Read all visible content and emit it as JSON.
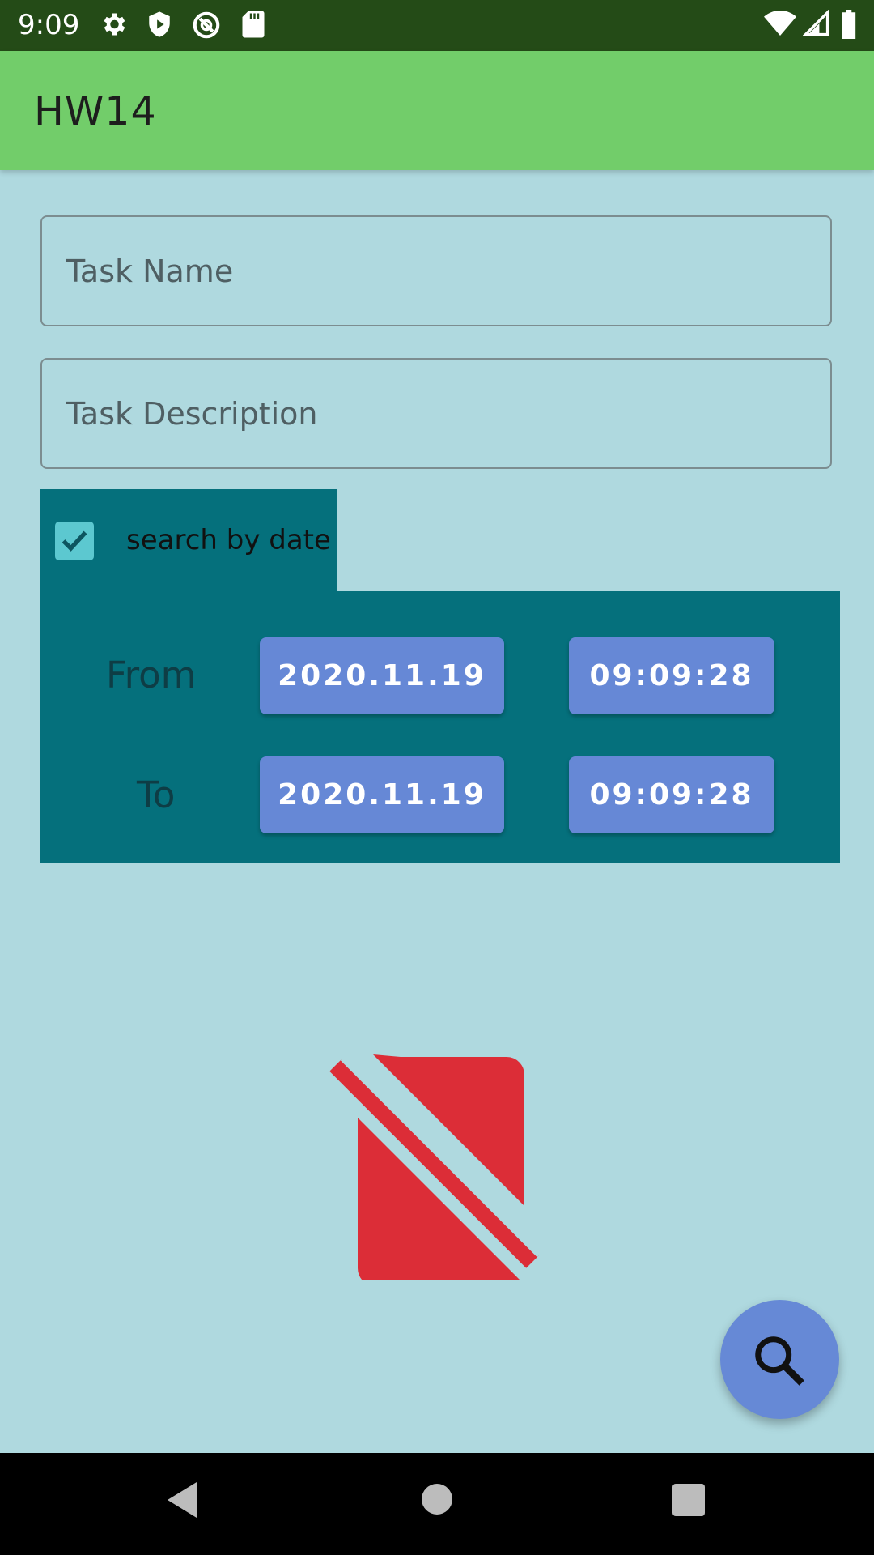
{
  "status_bar": {
    "time": "9:09",
    "icons_left": [
      "gear-icon",
      "shield-play-icon",
      "no-disturb-icon",
      "sd-card-icon"
    ],
    "icons_right": [
      "wifi-icon",
      "signal-icon",
      "battery-icon"
    ]
  },
  "app_bar": {
    "title": "HW14",
    "color": "#72cd6a"
  },
  "form": {
    "task_name_placeholder": "Task Name",
    "task_desc_placeholder": "Task Description",
    "search_by_date": {
      "label": "search by date",
      "checked": true
    },
    "from": {
      "label": "From",
      "date": "2020.11.19",
      "time": "09:09:28"
    },
    "to": {
      "label": "To",
      "date": "2020.11.19",
      "time": "09:09:28"
    }
  },
  "empty_state_icon": "no-sim-icon",
  "fab": {
    "icon": "search-icon"
  },
  "nav": {
    "buttons": [
      "back-icon",
      "home-icon",
      "recents-icon"
    ]
  },
  "colors": {
    "background": "#afd9df",
    "panel": "#05707c",
    "button": "#6688d6",
    "empty_icon": "#dc2d37"
  }
}
